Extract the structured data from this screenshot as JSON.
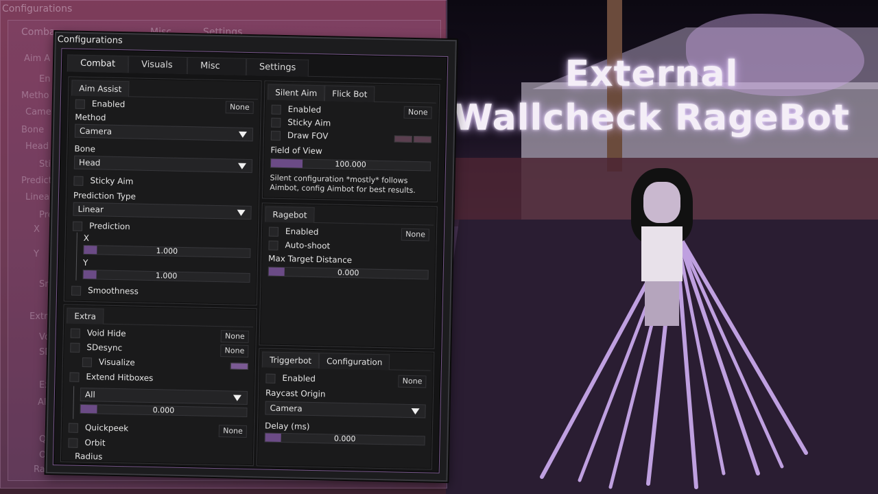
{
  "overlay": {
    "line1": "External",
    "line2": "Wallcheck RageBot"
  },
  "ghost": {
    "title": "Configurations",
    "tabs": [
      "Comba",
      "Misc",
      "Settings"
    ],
    "labels": [
      "Aim A",
      "En",
      "Metho",
      "Came",
      "Bone",
      "Head",
      "Sti",
      "Predict",
      "Linear",
      "Pre",
      "X",
      "Y",
      "Sm",
      "Extra",
      "Vo",
      "SD",
      "Ex",
      "All",
      "Qui",
      "Or",
      "Radi"
    ]
  },
  "window": {
    "title": "Configurations",
    "tabs": [
      "Combat",
      "Visuals",
      "Misc",
      "Settings"
    ]
  },
  "aim_assist": {
    "tab": "Aim Assist",
    "enabled_label": "Enabled",
    "enabled_key": "None",
    "method_label": "Method",
    "method_value": "Camera",
    "bone_label": "Bone",
    "bone_value": "Head",
    "sticky_label": "Sticky Aim",
    "pred_type_label": "Prediction Type",
    "pred_type_value": "Linear",
    "prediction_label": "Prediction",
    "x_label": "X",
    "x_value": "1.000",
    "x_fill": 0.08,
    "y_label": "Y",
    "y_value": "1.000",
    "y_fill": 0.08,
    "smoothness_label": "Smoothness"
  },
  "extra": {
    "tab": "Extra",
    "void_hide_label": "Void Hide",
    "void_hide_key": "None",
    "sdesync_label": "SDesync",
    "sdesync_key": "None",
    "visualize_label": "Visualize",
    "extend_label": "Extend Hitboxes",
    "extend_value": "All",
    "extend_slider": "0.000",
    "extend_fill": 0.1,
    "quickpeek_label": "Quickpeek",
    "quickpeek_key": "None",
    "orbit_label": "Orbit",
    "radius_label": "Radius"
  },
  "silent_aim": {
    "tabs": [
      "Silent Aim",
      "Flick Bot"
    ],
    "enabled_label": "Enabled",
    "enabled_key": "None",
    "sticky_label": "Sticky Aim",
    "fov_draw_label": "Draw FOV",
    "fov_label": "Field of View",
    "fov_value": "100.000",
    "fov_fill": 0.2,
    "note": "Silent configuration *mostly* follows Aimbot, config Aimbot for best results."
  },
  "ragebot": {
    "tab": "Ragebot",
    "enabled_label": "Enabled",
    "enabled_key": "None",
    "autoshoot_label": "Auto-shoot",
    "max_dist_label": "Max Target Distance",
    "max_dist_value": "0.000",
    "max_dist_fill": 0.1
  },
  "triggerbot": {
    "tabs": [
      "Triggerbot",
      "Configuration"
    ],
    "enabled_label": "Enabled",
    "enabled_key": "None",
    "origin_label": "Raycast Origin",
    "origin_value": "Camera",
    "delay_label": "Delay (ms)",
    "delay_value": "0.000",
    "delay_fill": 0.1
  },
  "colors": {
    "accent": "#6b4b86",
    "border_accent": "#7a5a8e",
    "panel": "#1a1a1b",
    "text": "#e6e6e6"
  }
}
